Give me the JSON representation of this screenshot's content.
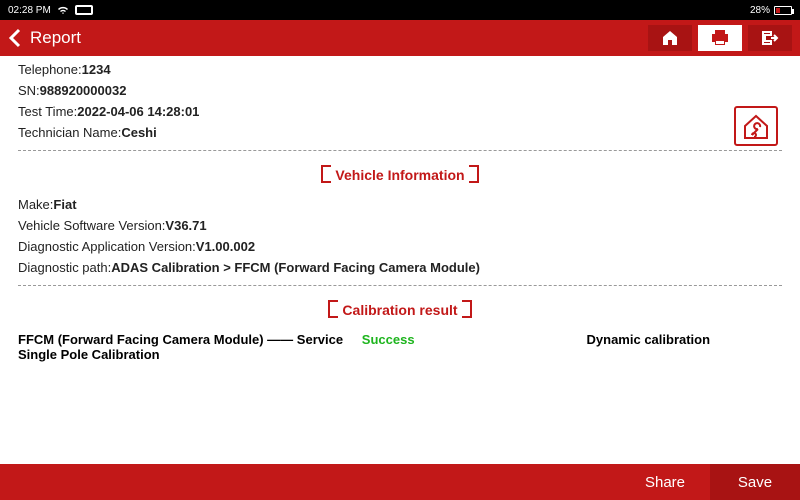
{
  "status": {
    "time": "02:28 PM",
    "battery": "28%"
  },
  "header": {
    "title": "Report"
  },
  "info": {
    "telephone_label": "Telephone:",
    "telephone_value": "1234",
    "sn_label": "SN:",
    "sn_value": "988920000032",
    "testtime_label": "Test Time:",
    "testtime_value": "2022-04-06 14:28:01",
    "tech_label": "Technician Name:",
    "tech_value": "Ceshi"
  },
  "section1_title": "Vehicle Information",
  "vehicle": {
    "make_label": "Make:",
    "make_value": "Fiat",
    "vsv_label": "Vehicle Software Version:",
    "vsv_value": "V36.71",
    "dav_label": "Diagnostic Application Version:",
    "dav_value": "V1.00.002",
    "path_label": "Diagnostic path:",
    "path_value": "ADAS Calibration > FFCM (Forward Facing Camera Module)"
  },
  "section2_title": "Calibration result",
  "result": {
    "module": "FFCM (Forward Facing Camera Module) —— Service Single Pole Calibration",
    "status": "Success",
    "type": "Dynamic calibration"
  },
  "footer": {
    "share": "Share",
    "save": "Save"
  }
}
